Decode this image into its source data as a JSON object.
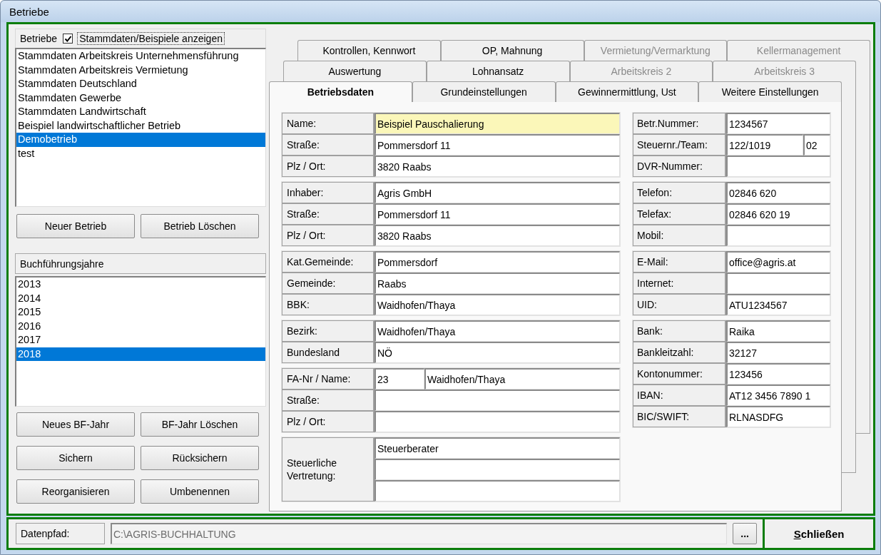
{
  "window": {
    "title": "Betriebe"
  },
  "betriebe": {
    "label": "Betriebe",
    "show_master": {
      "label": "Stammdaten/Beispiele anzeigen",
      "checked": true
    },
    "items": [
      {
        "label": "Stammdaten Arbeitskreis Unternehmensführung",
        "selected": false
      },
      {
        "label": "Stammdaten Arbeitskreis Vermietung",
        "selected": false
      },
      {
        "label": "Stammdaten Deutschland",
        "selected": false
      },
      {
        "label": "Stammdaten Gewerbe",
        "selected": false
      },
      {
        "label": "Stammdaten Landwirtschaft",
        "selected": false
      },
      {
        "label": "Beispiel landwirtschaftlicher Betrieb",
        "selected": false
      },
      {
        "label": "Demobetrieb",
        "selected": true
      },
      {
        "label": "test",
        "selected": false
      }
    ],
    "buttons": [
      "Neuer Betrieb",
      "Betrieb Löschen"
    ]
  },
  "years": {
    "label": "Buchführungsjahre",
    "items": [
      {
        "label": "2013",
        "selected": false
      },
      {
        "label": "2014",
        "selected": false
      },
      {
        "label": "2015",
        "selected": false
      },
      {
        "label": "2016",
        "selected": false
      },
      {
        "label": "2017",
        "selected": false
      },
      {
        "label": "2018",
        "selected": true
      }
    ],
    "buttons": [
      "Neues BF-Jahr",
      "BF-Jahr Löschen",
      "Sichern",
      "Rücksichern",
      "Reorganisieren",
      "Umbenennen"
    ]
  },
  "tab_rows": [
    [
      {
        "label": "Kontrollen, Kennwort",
        "selected": false,
        "disabled": false
      },
      {
        "label": "OP, Mahnung",
        "selected": false,
        "disabled": false
      },
      {
        "label": "Vermietung/Vermarktung",
        "selected": false,
        "disabled": true
      },
      {
        "label": "Kellermanagement",
        "selected": false,
        "disabled": true
      }
    ],
    [
      {
        "label": "Auswertung",
        "selected": false,
        "disabled": false
      },
      {
        "label": "Lohnansatz",
        "selected": false,
        "disabled": false
      },
      {
        "label": "Arbeitskreis 2",
        "selected": false,
        "disabled": true
      },
      {
        "label": "Arbeitskreis 3",
        "selected": false,
        "disabled": true
      }
    ],
    [
      {
        "label": "Betriebsdaten",
        "selected": true,
        "disabled": false
      },
      {
        "label": "Grundeinstellungen",
        "selected": false,
        "disabled": false
      },
      {
        "label": "Gewinnermittlung, Ust",
        "selected": false,
        "disabled": false
      },
      {
        "label": "Weitere Einstellungen",
        "selected": false,
        "disabled": false
      }
    ]
  ],
  "form": {
    "left_groups": [
      {
        "kind": "rows",
        "rows": [
          {
            "label": "Name:",
            "fields": [
              {
                "value": "Beispiel Pauschalierung",
                "focused": true
              }
            ]
          },
          {
            "label": "Straße:",
            "fields": [
              {
                "value": "Pommersdorf 11",
                "focused": false
              }
            ]
          },
          {
            "label": "Plz / Ort:",
            "fields": [
              {
                "value": "3820 Raabs",
                "focused": false
              }
            ]
          }
        ]
      },
      {
        "kind": "rows",
        "rows": [
          {
            "label": "Inhaber:",
            "fields": [
              {
                "value": "Agris GmbH",
                "focused": false
              }
            ]
          },
          {
            "label": "Straße:",
            "fields": [
              {
                "value": "Pommersdorf 11",
                "focused": false
              }
            ]
          },
          {
            "label": "Plz / Ort:",
            "fields": [
              {
                "value": "3820 Raabs",
                "focused": false
              }
            ]
          }
        ]
      },
      {
        "kind": "rows",
        "rows": [
          {
            "label": "Kat.Gemeinde:",
            "fields": [
              {
                "value": "Pommersdorf",
                "focused": false
              }
            ]
          },
          {
            "label": "Gemeinde:",
            "fields": [
              {
                "value": "Raabs",
                "focused": false
              }
            ]
          },
          {
            "label": "BBK:",
            "fields": [
              {
                "value": "Waidhofen/Thaya",
                "focused": false
              }
            ]
          }
        ]
      },
      {
        "kind": "rows",
        "rows": [
          {
            "label": "Bezirk:",
            "fields": [
              {
                "value": "Waidhofen/Thaya",
                "focused": false
              }
            ]
          },
          {
            "label": "Bundesland",
            "fields": [
              {
                "value": "NÖ",
                "focused": false
              }
            ]
          }
        ]
      },
      {
        "kind": "rows",
        "rows": [
          {
            "label": "FA-Nr / Name:",
            "fields": [
              {
                "value": "23",
                "focused": false,
                "kind": "short"
              },
              {
                "value": "Waidhofen/Thaya",
                "focused": false,
                "kind": "wide"
              }
            ]
          },
          {
            "label": "Straße:",
            "fields": [
              {
                "focused": false
              }
            ]
          },
          {
            "label": "Plz / Ort:",
            "fields": [
              {
                "focused": false
              }
            ]
          }
        ]
      },
      {
        "kind": "stacked",
        "label": "Steuerliche Vertretung:",
        "fields": [
          {
            "value": "Steuerberater",
            "focused": false
          },
          {
            "focused": false
          },
          {
            "focused": false
          }
        ]
      }
    ],
    "right_groups": [
      {
        "kind": "rows",
        "rows": [
          {
            "label": "Betr.Nummer:",
            "fields": [
              {
                "value": "1234567",
                "focused": false
              }
            ]
          },
          {
            "label": "Steuernr./Team:",
            "fields": [
              {
                "value": "122/1019",
                "focused": false,
                "kind": "wide"
              },
              {
                "value": "02",
                "focused": false,
                "kind": "short"
              }
            ]
          },
          {
            "label": "DVR-Nummer:",
            "fields": [
              {
                "focused": false
              }
            ]
          }
        ]
      },
      {
        "kind": "rows",
        "rows": [
          {
            "label": "Telefon:",
            "fields": [
              {
                "value": "02846 620",
                "focused": false
              }
            ]
          },
          {
            "label": "Telefax:",
            "fields": [
              {
                "value": "02846 620 19",
                "focused": false
              }
            ]
          },
          {
            "label": "Mobil:",
            "fields": [
              {
                "focused": false
              }
            ]
          }
        ]
      },
      {
        "kind": "rows",
        "rows": [
          {
            "label": "E-Mail:",
            "fields": [
              {
                "value": "office@agris.at",
                "focused": false
              }
            ]
          },
          {
            "label": "Internet:",
            "fields": [
              {
                "focused": false
              }
            ]
          },
          {
            "label": "UID:",
            "fields": [
              {
                "value": "ATU1234567",
                "focused": false
              }
            ]
          }
        ]
      },
      {
        "kind": "rows",
        "rows": [
          {
            "label": "Bank:",
            "fields": [
              {
                "value": "Raika",
                "focused": false
              }
            ]
          },
          {
            "label": "Bankleitzahl:",
            "fields": [
              {
                "value": "32127",
                "focused": false
              }
            ]
          },
          {
            "label": "Kontonummer:",
            "fields": [
              {
                "value": "123456",
                "focused": false
              }
            ]
          },
          {
            "label": "IBAN:",
            "fields": [
              {
                "value": "AT12 3456 7890 1",
                "focused": false
              }
            ]
          },
          {
            "label": "BIC/SWIFT:",
            "fields": [
              {
                "value": "RLNASDFG",
                "focused": false
              }
            ]
          }
        ]
      }
    ]
  },
  "footer": {
    "path_label": "Datenpfad:",
    "path": "C:\\AGRIS-BUCHHALTUNG",
    "browse": "...",
    "close": "Schließen"
  }
}
